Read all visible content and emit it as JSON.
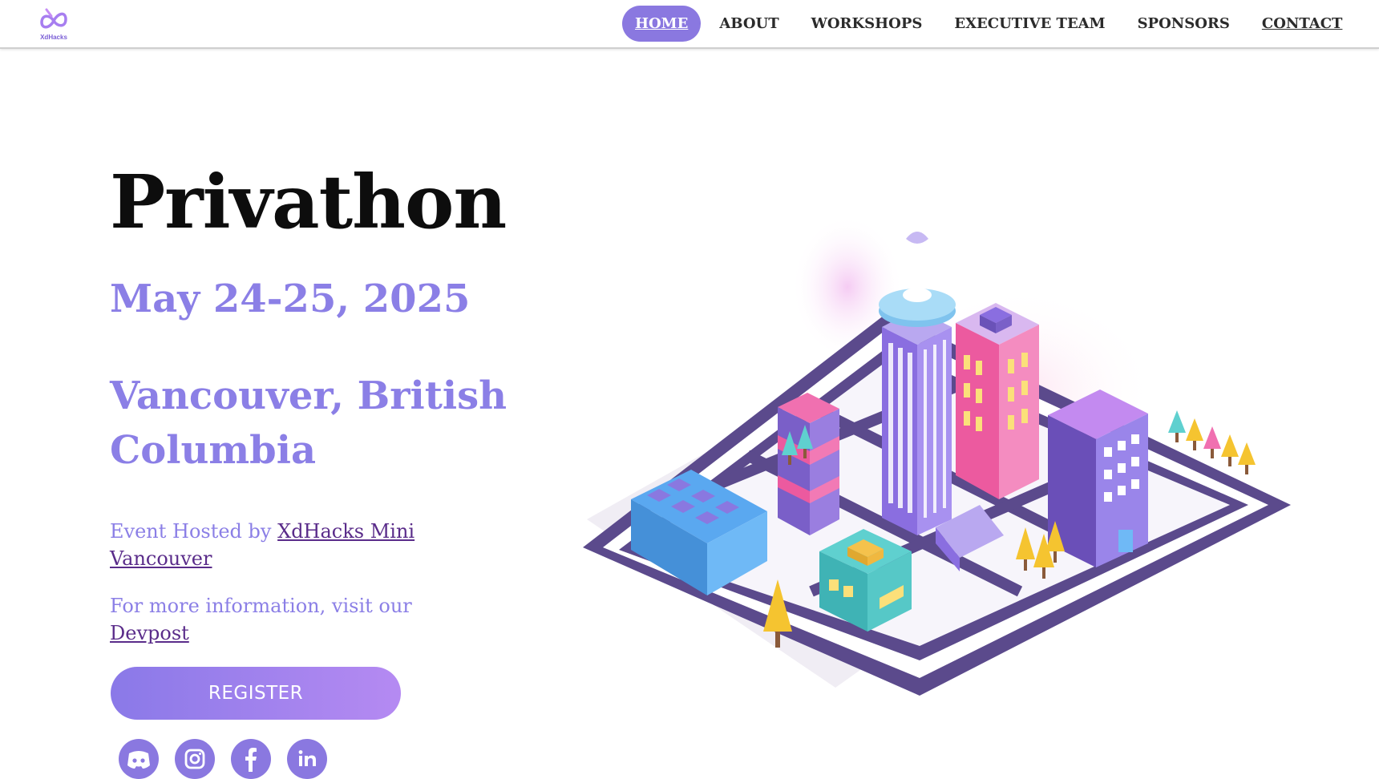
{
  "header": {
    "logo_text": "XdHacks",
    "nav": [
      {
        "label": "HOME"
      },
      {
        "label": "ABOUT"
      },
      {
        "label": "WORKSHOPS"
      },
      {
        "label": "EXECUTIVE TEAM"
      },
      {
        "label": "SPONSORS"
      },
      {
        "label": "CONTACT"
      }
    ]
  },
  "hero": {
    "title": "Privathon",
    "date": "May 24-25, 2025",
    "location": "Vancouver, British Columbia",
    "hosted_prefix": "Event Hosted by ",
    "hosted_link": "XdHacks Mini Vancouver",
    "more_prefix": "For more information, visit our ",
    "more_link": "Devpost",
    "register_label": "REGISTER"
  },
  "socials": [
    {
      "icon": "discord-icon"
    },
    {
      "icon": "instagram-icon"
    },
    {
      "icon": "facebook-icon"
    },
    {
      "icon": "linkedin-icon"
    }
  ],
  "colors": {
    "accent": "#8a78e0",
    "heading_purple": "#8b7fe6",
    "link_purple": "#5a2c8a",
    "title_black": "#0d0d0d"
  }
}
